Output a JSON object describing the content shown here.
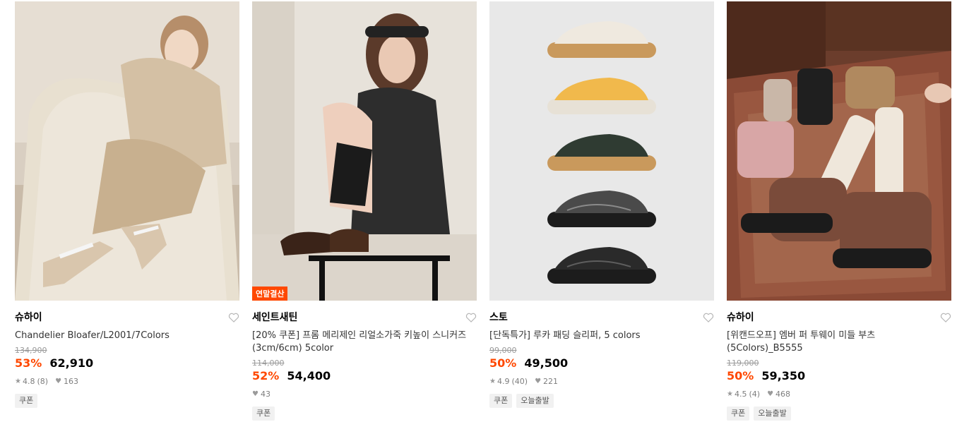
{
  "products": [
    {
      "brand": "슈하이",
      "name": "Chandelier Bloafer/L2001/7Colors",
      "badge": "",
      "original_price": "134,900",
      "discount": "53%",
      "price": "62,910",
      "rating": "4.8",
      "review_count": "(8)",
      "likes": "163",
      "tags": [
        "쿠폰"
      ]
    },
    {
      "brand": "세인트새틴",
      "name": "[20% 쿠폰] 프롬 메리제인 리얼소가죽 키높이 스니커즈 (3cm/6cm) 5color",
      "badge": "연말결산",
      "original_price": "114,000",
      "discount": "52%",
      "price": "54,400",
      "rating": "",
      "review_count": "",
      "likes": "43",
      "tags": [
        "쿠폰"
      ]
    },
    {
      "brand": "스토",
      "name": "[단독특가] 루카 패딩 슬리퍼, 5 colors",
      "badge": "",
      "original_price": "99,000",
      "discount": "50%",
      "price": "49,500",
      "rating": "4.9",
      "review_count": "(40)",
      "likes": "221",
      "tags": [
        "쿠폰",
        "오늘출발"
      ]
    },
    {
      "brand": "슈하이",
      "name": "[위캔드오프] 엠버 퍼 투웨이 미들 부츠(5Colors)_B5555",
      "badge": "",
      "original_price": "119,000",
      "discount": "50%",
      "price": "59,350",
      "rating": "4.5",
      "review_count": "(4)",
      "likes": "468",
      "tags": [
        "쿠폰",
        "오늘출발"
      ]
    }
  ],
  "icons": {
    "wishlist": "heart-outline-icon",
    "rating": "star-icon",
    "likes": "heart-filled-icon"
  },
  "colors": {
    "discount": "#ff4800",
    "badge_bg": "#ff4800"
  }
}
